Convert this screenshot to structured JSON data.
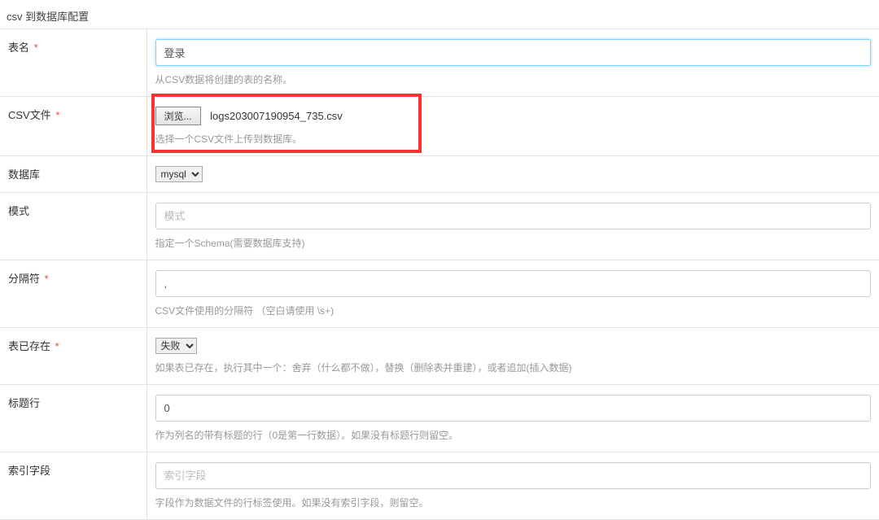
{
  "heading": "csv 到数据库配置",
  "rows": {
    "table_name": {
      "label": "表名",
      "required": true,
      "value": "登录",
      "help": "从CSV数据将创建的表的名称。"
    },
    "csv_file": {
      "label": "CSV文件",
      "required": true,
      "button": "浏览...",
      "filename": "logs203007190954_735.csv",
      "help": "选择一个CSV文件上传到数据库。"
    },
    "database": {
      "label": "数据库",
      "required": false,
      "value": "mysql"
    },
    "schema": {
      "label": "模式",
      "required": false,
      "placeholder": "模式",
      "value": "",
      "help": "指定一个Schema(需要数据库支持)"
    },
    "delimiter": {
      "label": "分隔符",
      "required": true,
      "value": ",",
      "help": "CSV文件使用的分隔符 （空白请使用 \\s+)"
    },
    "table_exists": {
      "label": "表已存在",
      "required": true,
      "value": "失败",
      "help": "如果表已存在，执行其中一个：舍弃（什么都不做），替换（删除表并重建），或者追加(插入数据)"
    },
    "header_row": {
      "label": "标题行",
      "required": false,
      "value": "0",
      "help": "作为列名的带有标题的行（0是第一行数据）。如果没有标题行则留空。"
    },
    "index_column": {
      "label": "索引字段",
      "required": false,
      "placeholder": "索引字段",
      "value": "",
      "help": "字段作为数据文件的行标签使用。如果没有索引字段，则留空。"
    }
  }
}
